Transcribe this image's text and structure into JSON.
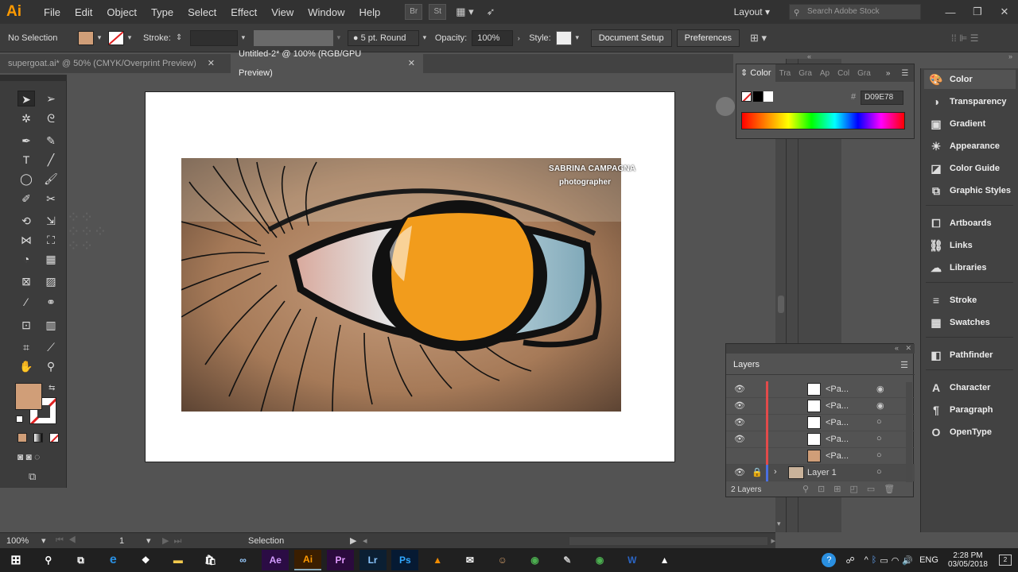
{
  "app": {
    "logo": "Ai"
  },
  "menu": [
    "File",
    "Edit",
    "Object",
    "Type",
    "Select",
    "Effect",
    "View",
    "Window",
    "Help"
  ],
  "menubar_right": {
    "btn_br": "Br",
    "btn_st": "St",
    "layout": "Layout",
    "search_placeholder": "Search Adobe Stock"
  },
  "control": {
    "selection": "No Selection",
    "fill_color": "#D09E78",
    "stroke_label": "Stroke:",
    "brush": "5 pt. Round",
    "opacity_label": "Opacity:",
    "opacity": "100%",
    "style_label": "Style:",
    "document_setup": "Document Setup",
    "preferences": "Preferences"
  },
  "tabs": [
    {
      "label": "supergoat.ai* @ 50% (CMYK/Overprint Preview)"
    },
    {
      "label": "Untitled-2* @ 100% (RGB/GPU Preview)"
    }
  ],
  "artwork": {
    "credit_name": "SABRINA CAMPAGNA",
    "credit_role": "photographer"
  },
  "status": {
    "zoom": "100%",
    "page": "1",
    "tool": "Selection"
  },
  "color_panel": {
    "tabs": [
      "Color",
      "Tra",
      "Gra",
      "Ap",
      "Col",
      "Gra"
    ],
    "hex_symbol": "#",
    "hex": "D09E78"
  },
  "dock": [
    {
      "label": "Color",
      "icon": "color-icon"
    },
    {
      "label": "Transparency",
      "icon": "transparency-icon"
    },
    {
      "label": "Gradient",
      "icon": "gradient-icon"
    },
    {
      "label": "Appearance",
      "icon": "appearance-icon"
    },
    {
      "label": "Color Guide",
      "icon": "color-guide-icon"
    },
    {
      "label": "Graphic Styles",
      "icon": "graphic-styles-icon"
    },
    {
      "label": "Artboards",
      "icon": "artboards-icon"
    },
    {
      "label": "Links",
      "icon": "links-icon"
    },
    {
      "label": "Libraries",
      "icon": "libraries-icon"
    },
    {
      "label": "Stroke",
      "icon": "stroke-icon"
    },
    {
      "label": "Swatches",
      "icon": "swatches-icon"
    },
    {
      "label": "Pathfinder",
      "icon": "pathfinder-icon"
    },
    {
      "label": "Character",
      "icon": "character-icon"
    },
    {
      "label": "Paragraph",
      "icon": "paragraph-icon"
    },
    {
      "label": "OpenType",
      "icon": "opentype-icon"
    }
  ],
  "layers": {
    "title": "Layers",
    "rows": [
      {
        "name": "<Pa..."
      },
      {
        "name": "<Pa..."
      },
      {
        "name": "<Pa..."
      },
      {
        "name": "<Pa..."
      },
      {
        "name": "<Pa..."
      }
    ],
    "layer1": "Layer 1",
    "count": "2 Layers"
  },
  "taskbar": {
    "apps": [
      "Ae",
      "Ai",
      "Pr",
      "Lr",
      "Ps"
    ],
    "lang": "ENG",
    "time": "2:28 PM",
    "date": "03/05/2018"
  }
}
